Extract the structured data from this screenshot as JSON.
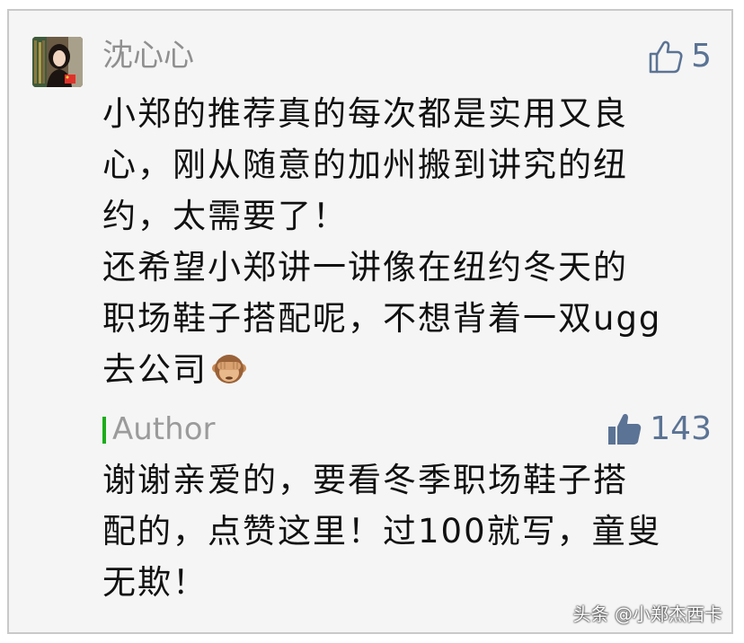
{
  "comment": {
    "user_name": "沈心心",
    "like_icon": "thumbs-up-outline-icon",
    "like_count": "5",
    "lines": [
      "小郑的推荐真的每次都是实用又良",
      "心，刚从随意的加州搬到讲究的纽",
      "约，太需要了！",
      "还希望小郑讲一讲像在纽约冬天的",
      "职场鞋子搭配呢，不想背着一双ugg",
      "去公司"
    ],
    "emoji": "see-no-evil-monkey-icon"
  },
  "reply": {
    "author_label": "Author",
    "like_icon": "thumbs-up-filled-icon",
    "like_count": "143",
    "lines": [
      "谢谢亲爱的，要看冬季职场鞋子搭",
      "配的，点赞这里！过100就写，童叟",
      "无欺！"
    ]
  },
  "watermark": "头条 @小郑杰西卡",
  "colors": {
    "background": "#f5f5f5",
    "name_gray": "#8f8f8f",
    "like_blue": "#5b7394",
    "author_marker_green": "#1aad19",
    "body_text": "#111111"
  }
}
